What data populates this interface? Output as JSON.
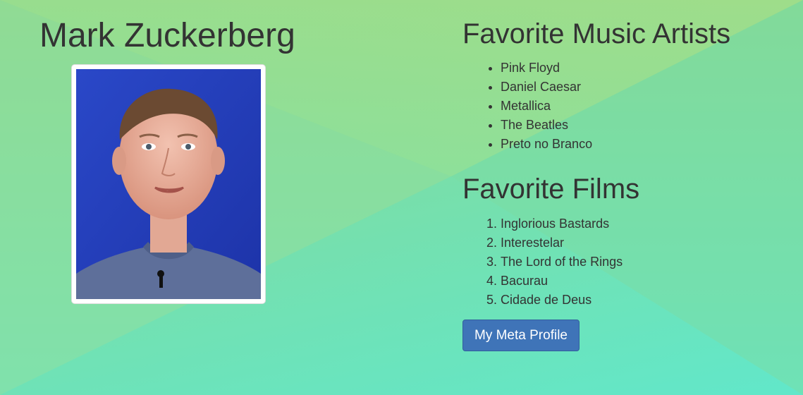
{
  "colors": {
    "background_top": "#97d88a",
    "background_bottom": "#63e8c8",
    "text": "#333333",
    "button_background": "#3f74b8",
    "button_text": "#ffffff"
  },
  "profile": {
    "name": "Mark Zuckerberg",
    "photo_icon": "portrait-photo"
  },
  "music": {
    "heading": "Favorite Music Artists",
    "items": [
      "Pink Floyd",
      "Daniel Caesar",
      "Metallica",
      "The Beatles",
      "Preto no Branco"
    ]
  },
  "films": {
    "heading": "Favorite Films",
    "items": [
      "Inglorious Bastards",
      "Interestelar",
      "The Lord of the Rings",
      "Bacurau",
      "Cidade de Deus"
    ]
  },
  "button": {
    "label": "My Meta Profile"
  }
}
